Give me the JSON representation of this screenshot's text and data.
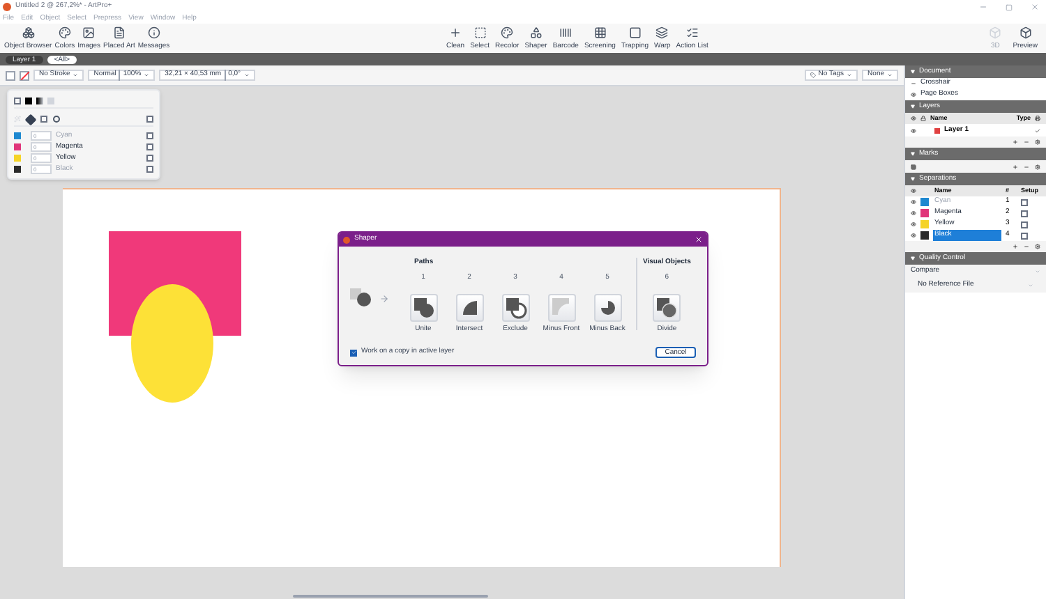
{
  "window": {
    "title": "Untitled 2 @ 267,2%* - ArtPro+"
  },
  "menu": [
    "File",
    "Edit",
    "Object",
    "Select",
    "Prepress",
    "View",
    "Window",
    "Help"
  ],
  "toolbar_left": [
    "Object Browser",
    "Colors",
    "Images",
    "Placed Art",
    "Messages"
  ],
  "toolbar_center": [
    "Clean",
    "Select",
    "Recolor",
    "Shaper",
    "Barcode",
    "Screening",
    "Trapping",
    "Warp",
    "Action List"
  ],
  "toolbar_right": [
    {
      "label": "3D",
      "disabled": true
    },
    {
      "label": "Preview",
      "disabled": false
    }
  ],
  "layer_tabs": [
    {
      "label": "Layer 1",
      "selected": false
    },
    {
      "label": "<All>",
      "selected": true
    }
  ],
  "options_bar": {
    "stroke": "No Stroke",
    "blend": "Normal",
    "opacity": "100%",
    "position": "32,21 × 40,53 mm",
    "angle": "0,0°",
    "tags": "No Tags",
    "none": "None"
  },
  "color_popup": {
    "overprint_checked": false,
    "inks": [
      {
        "name": "Cyan",
        "value": "0",
        "color": "#1e88d0",
        "disabled": true,
        "checked": false
      },
      {
        "name": "Magenta",
        "value": "0",
        "color": "#e0357a",
        "disabled": false,
        "checked": false
      },
      {
        "name": "Yellow",
        "value": "0",
        "color": "#f5d327",
        "disabled": false,
        "checked": false
      },
      {
        "name": "Black",
        "value": "0",
        "color": "#2a2a2a",
        "disabled": true,
        "checked": false
      }
    ]
  },
  "dialog": {
    "title": "Shaper",
    "paths_heading": "Paths",
    "visual_heading": "Visual Objects",
    "operations": [
      {
        "kind": "unite",
        "number": "1",
        "label": "Unite"
      },
      {
        "kind": "intersect",
        "number": "2",
        "label": "Intersect"
      },
      {
        "kind": "exclude",
        "number": "3",
        "label": "Exclude"
      },
      {
        "kind": "minus_front",
        "number": "4",
        "label": "Minus Front"
      },
      {
        "kind": "minus_back",
        "number": "5",
        "label": "Minus Back"
      }
    ],
    "visual_operations": [
      {
        "kind": "divide",
        "number": "6",
        "label": "Divide"
      }
    ],
    "copy_checkbox": {
      "label": "Work on a copy in active layer",
      "checked": true
    },
    "cancel": "Cancel"
  },
  "right_panel": {
    "document": {
      "title": "Document",
      "items": [
        "Crosshair",
        "Page Boxes"
      ]
    },
    "layers": {
      "title": "Layers",
      "columns": [
        "Name",
        "Type"
      ],
      "rows": [
        {
          "name": "Layer 1"
        }
      ]
    },
    "marks": {
      "title": "Marks"
    },
    "separations": {
      "title": "Separations",
      "columns": [
        "Name",
        "#",
        "Setup"
      ],
      "rows": [
        {
          "name": "Cyan",
          "number": "1",
          "color": "#1e88d0",
          "disabled": true,
          "selected": false,
          "setup_checked": false
        },
        {
          "name": "Magenta",
          "number": "2",
          "color": "#e0357a",
          "disabled": false,
          "selected": false,
          "setup_checked": false
        },
        {
          "name": "Yellow",
          "number": "3",
          "color": "#f5d327",
          "disabled": false,
          "selected": false,
          "setup_checked": false
        },
        {
          "name": "Black",
          "number": "4",
          "color": "#2a2a2a",
          "disabled": false,
          "selected": true,
          "setup_checked": false
        }
      ]
    },
    "quality_control": {
      "title": "Quality Control",
      "compare": "Compare",
      "reference": "No Reference File"
    }
  }
}
